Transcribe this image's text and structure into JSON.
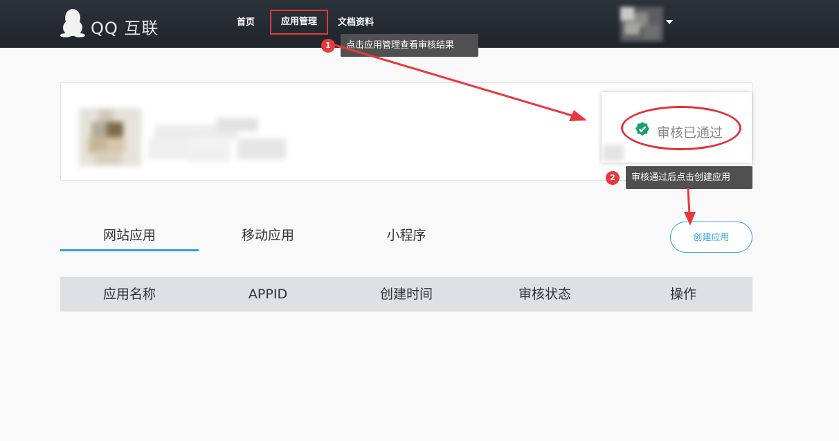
{
  "header": {
    "logo_text": "QQ 互联",
    "nav": {
      "home": "首页",
      "app_management": "应用管理",
      "docs": "文档资料"
    }
  },
  "annotations": [
    {
      "step": "1",
      "text": "点击应用管理查看审核结果"
    },
    {
      "step": "2",
      "text": "审核通过后点击创建应用"
    }
  ],
  "developer_card": {
    "review_status": "审核已通过"
  },
  "tabs": [
    {
      "label": "网站应用",
      "active": true
    },
    {
      "label": "移动应用",
      "active": false
    },
    {
      "label": "小程序",
      "active": false
    }
  ],
  "actions": {
    "create_app": "创建应用"
  },
  "table": {
    "columns": [
      "应用名称",
      "APPID",
      "创建时间",
      "审核状态",
      "操作"
    ]
  },
  "colors": {
    "accent": "#2aa2e1",
    "highlight_red": "#e03a3a",
    "success_green": "#12a36b"
  },
  "icons": [
    "qq-penguin-icon",
    "dropdown-caret-icon",
    "verified-check-icon"
  ]
}
